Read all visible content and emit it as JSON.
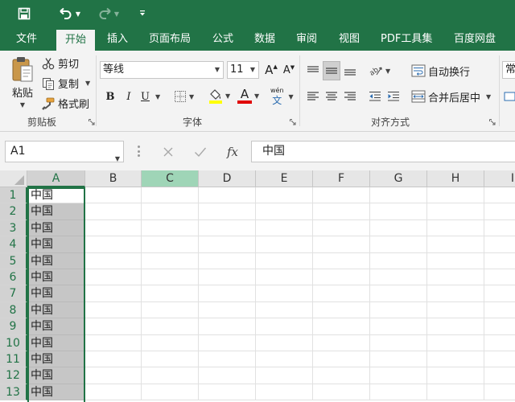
{
  "title_bar": {
    "icons": [
      "save-icon",
      "undo-icon",
      "redo-icon",
      "customize-icon"
    ],
    "accent": "#217346"
  },
  "tabs": [
    {
      "label": "文件",
      "active": false
    },
    {
      "label": "开始",
      "active": true
    },
    {
      "label": "插入",
      "active": false
    },
    {
      "label": "页面布局",
      "active": false
    },
    {
      "label": "公式",
      "active": false
    },
    {
      "label": "数据",
      "active": false
    },
    {
      "label": "审阅",
      "active": false
    },
    {
      "label": "视图",
      "active": false
    },
    {
      "label": "PDF工具集",
      "active": false
    },
    {
      "label": "百度网盘",
      "active": false
    }
  ],
  "ribbon": {
    "clipboard": {
      "paste": "粘贴",
      "cut": "剪切",
      "copy": "复制",
      "format_painter": "格式刷",
      "group_label": "剪贴板"
    },
    "font": {
      "font_name": "等线",
      "font_size": "11",
      "bold": "B",
      "italic": "I",
      "underline": "U",
      "grow": "A",
      "shrink": "A",
      "phonetic": "wén",
      "phonetic_char": "文",
      "font_color_letter": "A",
      "highlight_color": "#ffff00",
      "font_color": "#e00000",
      "group_label": "字体"
    },
    "alignment": {
      "wrap_text": "自动换行",
      "merge_center": "合并后居中",
      "group_label": "对齐方式"
    },
    "number": {
      "format": "常"
    }
  },
  "formula_bar": {
    "name_box": "A1",
    "fx": "fx",
    "content": "中国"
  },
  "sheet": {
    "columns": [
      "A",
      "B",
      "C",
      "D",
      "E",
      "F",
      "G",
      "H",
      "I"
    ],
    "rows": [
      "1",
      "2",
      "3",
      "4",
      "5",
      "6",
      "7",
      "8",
      "9",
      "10",
      "11",
      "12",
      "13"
    ],
    "column_a_values": [
      "中国",
      "中国",
      "中国",
      "中国",
      "中国",
      "中国",
      "中国",
      "中国",
      "中国",
      "中国",
      "中国",
      "中国",
      "中国"
    ],
    "active_cell": "A1",
    "selection_color": "#217346"
  }
}
